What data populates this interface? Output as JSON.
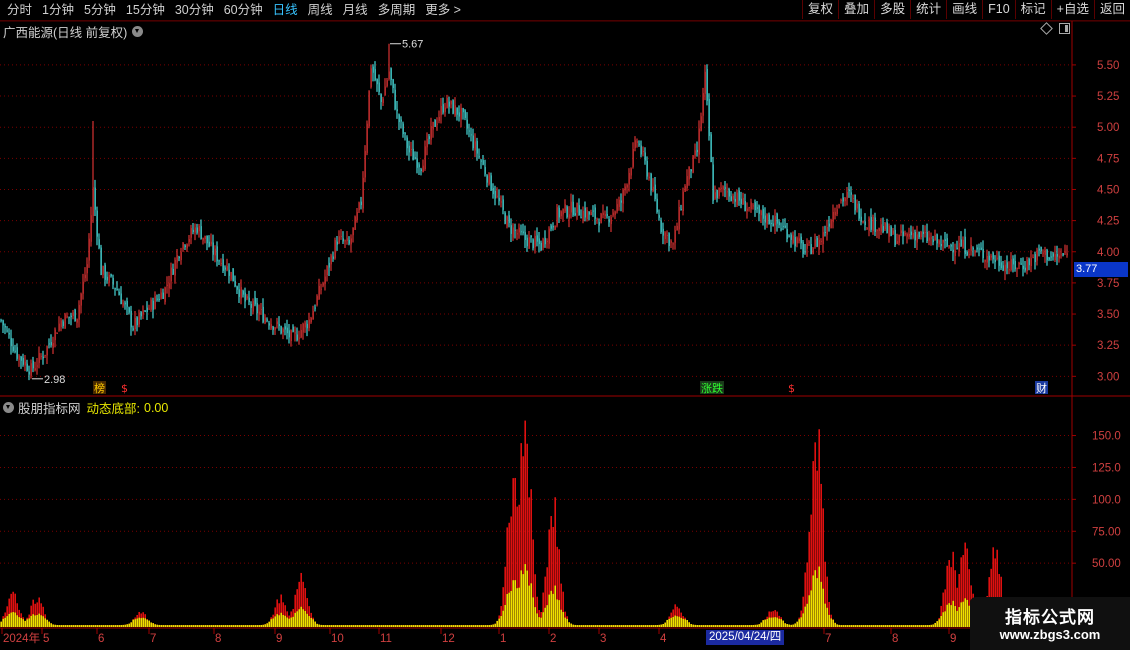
{
  "toolbar": {
    "periods": [
      "分时",
      "1分钟",
      "5分钟",
      "15分钟",
      "30分钟",
      "60分钟",
      "日线",
      "周线",
      "月线",
      "多周期",
      "更多 >"
    ],
    "active_period": "日线",
    "actions": [
      "复权",
      "叠加",
      "多股",
      "统计",
      "画线",
      "F10",
      "标记",
      "+自选",
      "返回"
    ]
  },
  "main_panel": {
    "title": "广西能源(日线 前复权)",
    "last_price_badge": "3.77",
    "high_annotation": "5.67",
    "low_annotation": "2.98",
    "markers": [
      {
        "text": "榜",
        "color": "#ffcc00",
        "bg": "#4a2a00"
      },
      {
        "text": "$",
        "color": "#ff3030",
        "bg": ""
      },
      {
        "text": "涨跌",
        "color": "#30ff30",
        "bg": "#1a3a1a"
      },
      {
        "text": "$",
        "color": "#ff3030",
        "bg": ""
      },
      {
        "text": "财",
        "color": "#ffffff",
        "bg": "#1a3aa0"
      }
    ]
  },
  "indicator_panel": {
    "title": "股朋指标网",
    "legend_label": "动态底部:",
    "legend_value": "0.00"
  },
  "x_axis": {
    "labels": [
      "2024年",
      "5",
      "6",
      "7",
      "8",
      "9",
      "10",
      "11",
      "12",
      "1",
      "2",
      "3",
      "4",
      "2025/04/24/四",
      "7",
      "8",
      "9",
      "10"
    ],
    "cursor_date": "2025/04/24/四"
  },
  "watermark": {
    "title": "指标公式网",
    "url": "www.zbgs3.com"
  },
  "colors": {
    "up": "#ff3b3b",
    "down": "#54ffff",
    "grid": "#7a0000",
    "axis_text": "#d04040",
    "bar_red": "#e01010",
    "bar_yellow": "#f0e000"
  },
  "chart_data": [
    {
      "type": "candlestick",
      "title": "广西能源(日线 前复权)",
      "y_ticks": [
        3.0,
        3.25,
        3.5,
        3.75,
        4.0,
        4.25,
        4.5,
        4.75,
        5.0,
        5.25,
        5.5
      ],
      "ylim": [
        2.85,
        5.7
      ],
      "close_anchor_points": [
        [
          0,
          3.45
        ],
        [
          8,
          3.18
        ],
        [
          15,
          3.05
        ],
        [
          22,
          3.2
        ],
        [
          30,
          3.45
        ],
        [
          38,
          3.5
        ],
        [
          43,
          3.9
        ],
        [
          46,
          4.5
        ],
        [
          50,
          3.85
        ],
        [
          58,
          3.7
        ],
        [
          66,
          3.4
        ],
        [
          74,
          3.55
        ],
        [
          82,
          3.7
        ],
        [
          90,
          4.05
        ],
        [
          98,
          4.2
        ],
        [
          106,
          4.0
        ],
        [
          114,
          3.85
        ],
        [
          122,
          3.6
        ],
        [
          130,
          3.5
        ],
        [
          138,
          3.4
        ],
        [
          146,
          3.3
        ],
        [
          154,
          3.45
        ],
        [
          162,
          3.8
        ],
        [
          168,
          4.1
        ],
        [
          174,
          4.05
        ],
        [
          180,
          4.4
        ],
        [
          185,
          5.5
        ],
        [
          190,
          5.2
        ],
        [
          194,
          5.45
        ],
        [
          198,
          5.1
        ],
        [
          204,
          4.8
        ],
        [
          210,
          4.7
        ],
        [
          216,
          5.0
        ],
        [
          222,
          5.2
        ],
        [
          230,
          5.1
        ],
        [
          238,
          4.8
        ],
        [
          246,
          4.5
        ],
        [
          254,
          4.2
        ],
        [
          262,
          4.1
        ],
        [
          270,
          4.05
        ],
        [
          278,
          4.3
        ],
        [
          286,
          4.35
        ],
        [
          294,
          4.3
        ],
        [
          302,
          4.25
        ],
        [
          310,
          4.4
        ],
        [
          318,
          4.9
        ],
        [
          324,
          4.6
        ],
        [
          330,
          4.2
        ],
        [
          336,
          4.05
        ],
        [
          342,
          4.55
        ],
        [
          348,
          4.8
        ],
        [
          352,
          5.4
        ],
        [
          356,
          4.45
        ],
        [
          362,
          4.5
        ],
        [
          370,
          4.4
        ],
        [
          378,
          4.3
        ],
        [
          386,
          4.25
        ],
        [
          394,
          4.15
        ],
        [
          402,
          4.0
        ],
        [
          410,
          4.1
        ],
        [
          418,
          4.4
        ],
        [
          424,
          4.45
        ],
        [
          432,
          4.25
        ],
        [
          440,
          4.2
        ],
        [
          448,
          4.1
        ],
        [
          456,
          4.15
        ],
        [
          464,
          4.1
        ],
        [
          472,
          4.05
        ],
        [
          480,
          4.05
        ],
        [
          488,
          4.0
        ],
        [
          496,
          3.95
        ],
        [
          504,
          3.88
        ],
        [
          512,
          3.9
        ],
        [
          520,
          4.0
        ],
        [
          526,
          3.95
        ],
        [
          533,
          3.98
        ]
      ],
      "annotations": {
        "high": 5.67,
        "low": 2.98,
        "last": 3.77
      }
    },
    {
      "type": "bar",
      "title": "股朋指标网",
      "series": [
        {
          "name": "动态底部",
          "values_description": "stacked red/yellow histogram spikes"
        }
      ],
      "y_ticks": [
        50.0,
        75.0,
        100.0,
        125.0,
        150.0
      ],
      "ylim": [
        0,
        170
      ],
      "spike_clusters": [
        {
          "center": 6,
          "height": 25
        },
        {
          "center": 18,
          "height": 22
        },
        {
          "center": 70,
          "height": 10
        },
        {
          "center": 140,
          "height": 22
        },
        {
          "center": 150,
          "height": 38
        },
        {
          "center": 256,
          "height": 115
        },
        {
          "center": 262,
          "height": 160
        },
        {
          "center": 276,
          "height": 95
        },
        {
          "center": 338,
          "height": 15
        },
        {
          "center": 386,
          "height": 14
        },
        {
          "center": 406,
          "height": 100
        },
        {
          "center": 408,
          "height": 155
        },
        {
          "center": 475,
          "height": 55
        },
        {
          "center": 482,
          "height": 60
        },
        {
          "center": 497,
          "height": 60
        }
      ]
    }
  ]
}
